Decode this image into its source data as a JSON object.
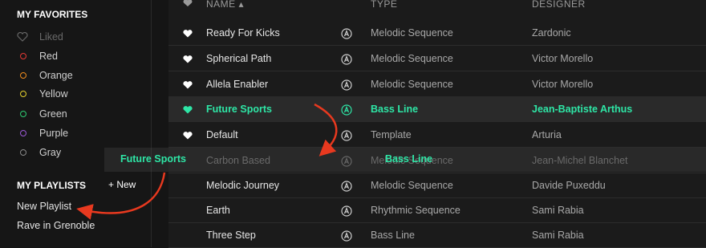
{
  "favorites": {
    "title": "MY FAVORITES",
    "items": [
      {
        "label": "Liked",
        "icon": "heart-outline-icon",
        "dim": true
      },
      {
        "label": "Red",
        "color": "#e53935"
      },
      {
        "label": "Orange",
        "color": "#ef8c1e"
      },
      {
        "label": "Yellow",
        "color": "#e3d02e"
      },
      {
        "label": "Green",
        "color": "#2ecc71"
      },
      {
        "label": "Purple",
        "color": "#9b59d6"
      },
      {
        "label": "Gray",
        "color": "#8a8a8a"
      }
    ]
  },
  "playlists": {
    "title": "MY PLAYLISTS",
    "new_label": "+ New",
    "items": [
      "New Playlist",
      "Rave in Grenoble"
    ]
  },
  "table": {
    "headers": {
      "name": "NAME",
      "type": "TYPE",
      "designer": "DESIGNER"
    },
    "rows": [
      {
        "name": "Ready For Kicks",
        "type": "Melodic Sequence",
        "designer": "Zardonic",
        "liked": true
      },
      {
        "name": "Spherical Path",
        "type": "Melodic Sequence",
        "designer": "Victor Morello",
        "liked": true
      },
      {
        "name": "Allela Enabler",
        "type": "Melodic Sequence",
        "designer": "Victor Morello",
        "liked": true
      },
      {
        "name": "Future Sports",
        "type": "Bass Line",
        "designer": "Jean-Baptiste Arthus",
        "liked": true,
        "selected": true
      },
      {
        "name": "Default",
        "type": "Template",
        "designer": "Arturia",
        "liked": true
      },
      {
        "name": "Carbon Based",
        "type": "Melodic Sequence",
        "designer": "Jean-Michel Blanchet",
        "liked": false,
        "ghost": true
      },
      {
        "name": "Melodic Journey",
        "type": "Melodic Sequence",
        "designer": "Davide Puxeddu",
        "liked": false
      },
      {
        "name": "Earth",
        "type": "Rhythmic Sequence",
        "designer": "Sami Rabia",
        "liked": false
      },
      {
        "name": "Three Step",
        "type": "Bass Line",
        "designer": "Sami Rabia",
        "liked": false
      }
    ]
  },
  "drag": {
    "name_label": "Future Sports",
    "type_label": "Bass Line"
  },
  "colors": {
    "accent": "#2ee6a6",
    "arrow": "#e8391f"
  }
}
